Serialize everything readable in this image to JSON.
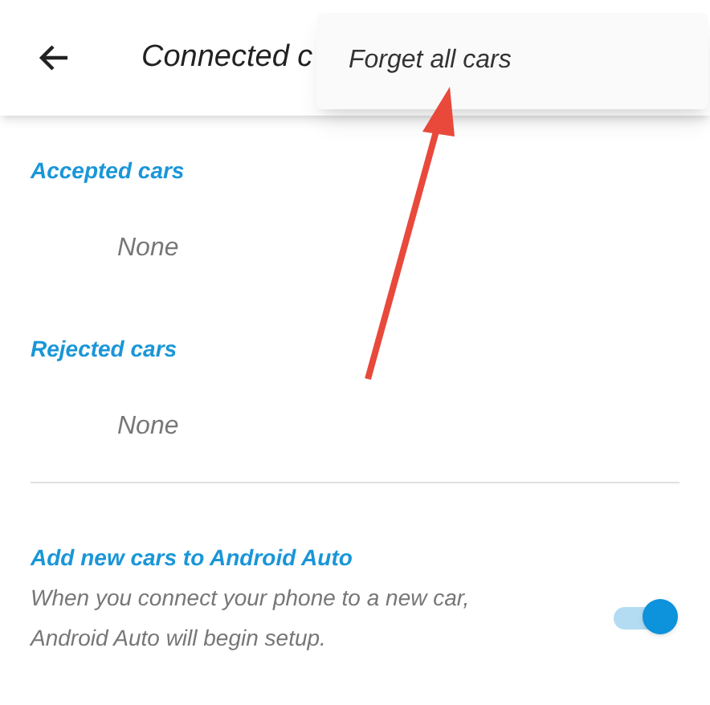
{
  "app_bar": {
    "title": "Connected c"
  },
  "menu": {
    "items": [
      "Forget all cars"
    ]
  },
  "sections": [
    {
      "heading": "Accepted cars",
      "value": "None"
    },
    {
      "heading": "Rejected cars",
      "value": "None"
    }
  ],
  "setting": {
    "title": "Add new cars to Android Auto",
    "description": "When you connect your phone to a new car, Android Auto will begin setup.",
    "on": true
  },
  "annotation": {
    "kind": "arrow"
  }
}
